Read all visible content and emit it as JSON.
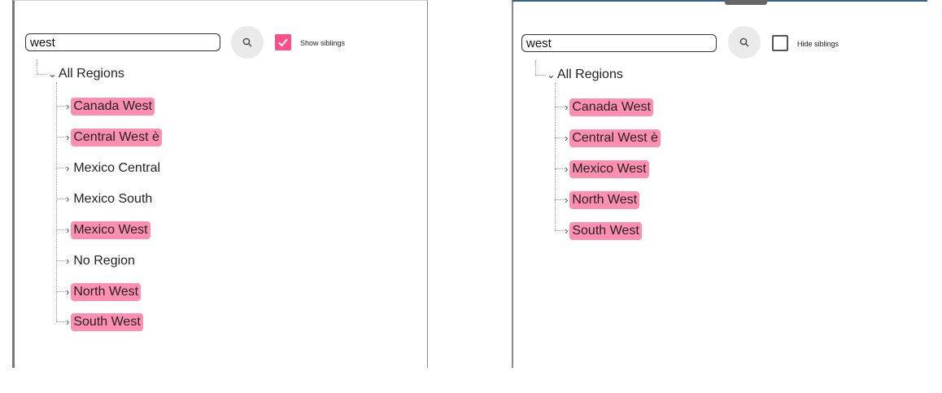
{
  "left": {
    "search": {
      "value": "west"
    },
    "checkbox": {
      "label": "Show siblings",
      "checked": true
    },
    "tree": {
      "root": "All Regions",
      "items": [
        {
          "label": "Canada West",
          "highlighted": true
        },
        {
          "label": "Central West è",
          "highlighted": true
        },
        {
          "label": "Mexico Central",
          "highlighted": false
        },
        {
          "label": "Mexico South",
          "highlighted": false
        },
        {
          "label": "Mexico West",
          "highlighted": true
        },
        {
          "label": "No Region",
          "highlighted": false
        },
        {
          "label": "North West",
          "highlighted": true
        },
        {
          "label": "South West",
          "highlighted": true
        }
      ]
    }
  },
  "right": {
    "search": {
      "value": "west"
    },
    "checkbox": {
      "label": "Hide siblings",
      "checked": false
    },
    "tree": {
      "root": "All Regions",
      "items": [
        {
          "label": "Canada West",
          "highlighted": true
        },
        {
          "label": "Central West è",
          "highlighted": true
        },
        {
          "label": "Mexico West",
          "highlighted": true
        },
        {
          "label": "North West",
          "highlighted": true
        },
        {
          "label": "South West",
          "highlighted": true
        }
      ]
    }
  },
  "icons": {
    "search": "search-icon",
    "check": "check-icon",
    "expand": "chevron-right-icon",
    "collapse": "chevron-down-icon"
  },
  "colors": {
    "highlight": "#ff8fb0",
    "checkbox_checked": "#ff4f8b",
    "panel_accent": "#3a5f8a"
  }
}
